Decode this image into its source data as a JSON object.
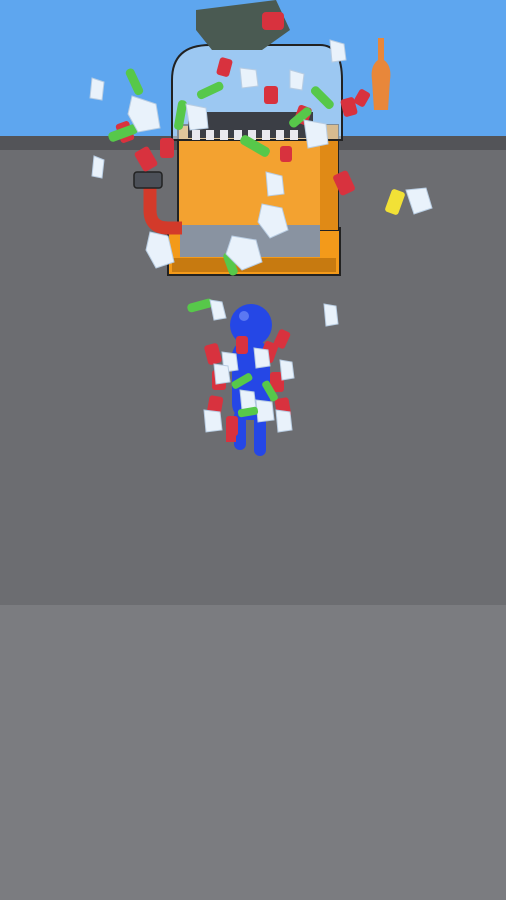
{
  "scene": {
    "sky_color": "#5ea6ef",
    "floor_rim_color": "#535458",
    "floor_color": "#6c6d71",
    "near_floor_color": "#7b7c80"
  },
  "machine": {
    "body_color": "#f3a230",
    "base_color": "#f39a1a",
    "pipe_color": "#d33a2a",
    "dome_color": "#cfe3f4"
  },
  "player": {
    "color": "#2547e6"
  },
  "debris": {
    "can_color": "#d8323e",
    "bottle_color": "#57c84a",
    "ice_color": "#e9f2fb"
  }
}
